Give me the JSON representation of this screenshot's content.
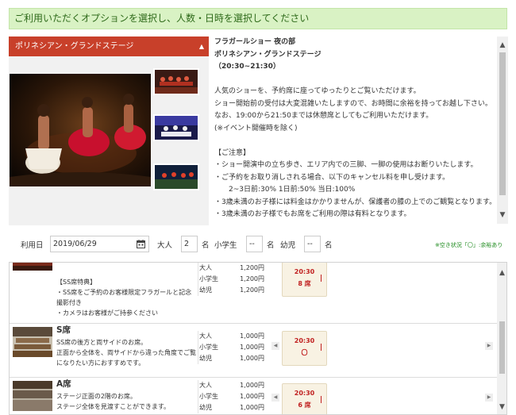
{
  "banner": {
    "text": "ご利用いただくオプションを選択し、人数・日時を選択してください"
  },
  "gallery": {
    "title": "ポリネシアン・グランドステージ",
    "caret": "▲"
  },
  "description": {
    "lines": [
      "フラガールショー 夜の部",
      "ポリネシアン・グランドステージ",
      "（20:30~21:30）",
      "",
      "人気のショーを、予約席に座ってゆったりとご覧いただけます。",
      "ショー開始前の受付は大変混雑いたしますので、お時間に余裕を持ってお越し下さい。",
      "なお、19:00から21:50までは休憩席としてもご利用いただけます。",
      "(※イベント開催時を除く)",
      "",
      "【ご注意】",
      "・ショー開演中の立ち歩き、エリア内での三脚、一脚の使用はお断りいたします。",
      "・ご予約をお取り消しされる場合、以下のキャンセル料を申し受けます。",
      "　　2~3日前:30% 1日前:50% 当日:100%",
      "・3歳未満のお子様には料金はかかりませんが、保護者の膝の上でのご観覧となります。",
      "・3歳未満のお子様でもお席をご利用の際は有料となります。"
    ]
  },
  "form": {
    "date_label": "利用日",
    "date_value": "2019/06/29",
    "adult_label": "大人",
    "adult_value": "2",
    "adult_unit": "名",
    "child_label": "小学生",
    "child_value": "--",
    "child_unit": "名",
    "infant_label": "幼児",
    "infant_value": "--",
    "infant_unit": "名",
    "note": "※空き状況「〇」:余裕あり"
  },
  "rows": [
    {
      "name": "",
      "text_lines": [
        "【SS席特典】",
        "・SS席をご予約のお客様限定フラガールと記念撮影付き",
        "・カメラはお客様がご持参ください"
      ],
      "prices": [
        {
          "label": "大人",
          "amount": "1,200円"
        },
        {
          "label": "小学生",
          "amount": "1,200円"
        },
        {
          "label": "幼児",
          "amount": "1,200円"
        }
      ],
      "slot_time": "20:30",
      "slot_status": "8 席"
    },
    {
      "name": "S席",
      "text_lines": [
        "SS席の後方と両サイドのお席。",
        "正面から全体を、両サイドから違った角度でご覧になりたい方におすすめです。"
      ],
      "prices": [
        {
          "label": "大人",
          "amount": "1,000円"
        },
        {
          "label": "小学生",
          "amount": "1,000円"
        },
        {
          "label": "幼児",
          "amount": "1,000円"
        }
      ],
      "slot_time": "20:30",
      "slot_status": "〇"
    },
    {
      "name": "A席",
      "text_lines": [
        "ステージ正面の2階のお席。",
        "ステージ全体を見渡すことができます。"
      ],
      "prices": [
        {
          "label": "大人",
          "amount": "1,000円"
        },
        {
          "label": "小学生",
          "amount": "1,000円"
        },
        {
          "label": "幼児",
          "amount": "1,000円"
        }
      ],
      "slot_time": "20:30",
      "slot_status": "6 席"
    }
  ],
  "icons": {
    "calendar": "calendar-icon",
    "scroll_up": "▲",
    "scroll_down": "▼",
    "prev": "◀",
    "next": "▶"
  },
  "colors": {
    "banner_bg": "#d9f2c4",
    "gallery_header": "#c8402a",
    "slot_text": "#c02020",
    "note_text": "#1c8a1c"
  }
}
